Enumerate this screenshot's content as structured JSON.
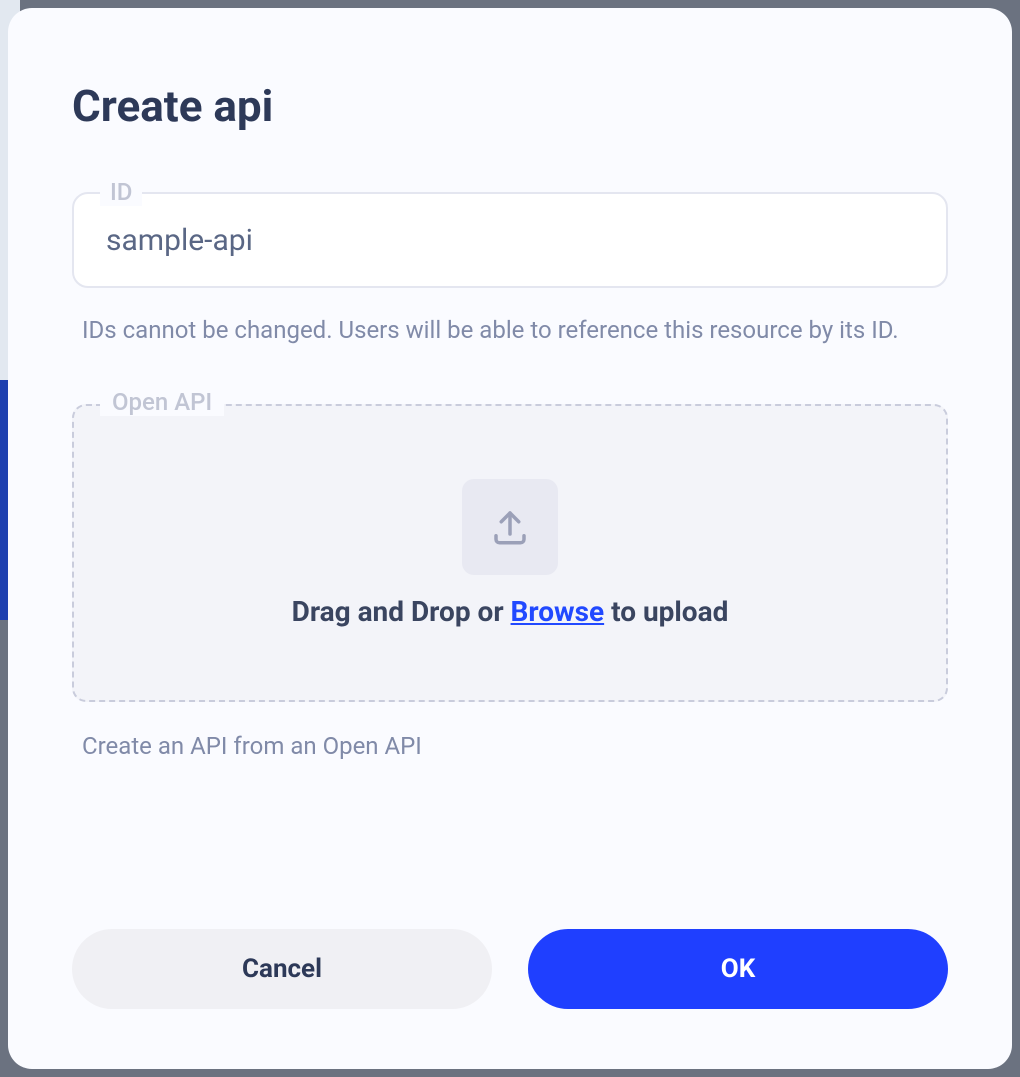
{
  "modal": {
    "title": "Create api",
    "id_field": {
      "label": "ID",
      "value": "sample-api",
      "help": "IDs cannot be changed. Users will be able to reference this resource by its ID."
    },
    "openapi_field": {
      "label": "Open API",
      "drop_prefix": "Drag and Drop or ",
      "browse": "Browse",
      "drop_suffix": " to upload",
      "help": "Create an API from an Open API"
    },
    "buttons": {
      "cancel": "Cancel",
      "ok": "OK"
    }
  }
}
